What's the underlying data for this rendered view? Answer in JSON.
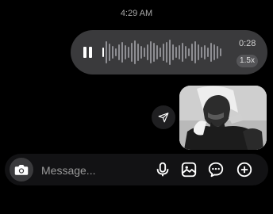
{
  "thread": {
    "timestamp": "4:29 AM"
  },
  "voice_message": {
    "duration": "0:28",
    "playback_speed": "1.5x",
    "state": "playing",
    "progress": 0.02
  },
  "image_message": {
    "alt": "Photo of a man in a white headscarf"
  },
  "composer": {
    "placeholder": "Message..."
  },
  "icons": {
    "pause": "pause-icon",
    "share": "send-icon",
    "camera": "camera-icon",
    "mic": "microphone-icon",
    "gallery": "gallery-icon",
    "sticker": "sticker-icon",
    "add": "plus-icon"
  },
  "colors": {
    "background": "#000000",
    "bubble": "#3a3a3c",
    "composer": "#121214",
    "wave_played": "#ffffff",
    "wave_unplayed": "#8e8e93"
  }
}
